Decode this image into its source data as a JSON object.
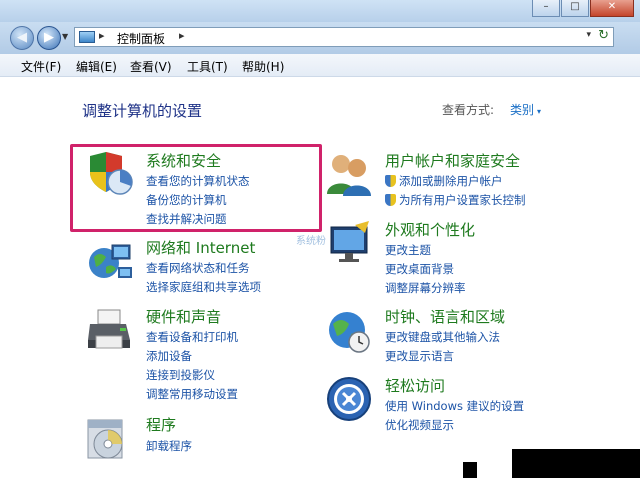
{
  "window": {
    "minimize": "–",
    "maximize": "□",
    "close": "✕"
  },
  "address": {
    "crumb": "控制面板",
    "sep": "▸",
    "dropdown": "▾",
    "refresh": "↻"
  },
  "menu": [
    "文件(F)",
    "编辑(E)",
    "查看(V)",
    "工具(T)",
    "帮助(H)"
  ],
  "page": {
    "title": "调整计算机的设置",
    "view_by_label": "查看方式:",
    "view_by_value": "类别"
  },
  "left_categories": [
    {
      "title": "系统和安全",
      "links": [
        "查看您的计算机状态",
        "备份您的计算机",
        "查找并解决问题"
      ],
      "icon": "shield-pie-icon"
    },
    {
      "title": "网络和 Internet",
      "links": [
        "查看网络状态和任务",
        "选择家庭组和共享选项"
      ],
      "icon": "globe-network-icon"
    },
    {
      "title": "硬件和声音",
      "links": [
        "查看设备和打印机",
        "添加设备",
        "连接到投影仪",
        "调整常用移动设置"
      ],
      "icon": "printer-icon"
    },
    {
      "title": "程序",
      "links": [
        "卸载程序"
      ],
      "icon": "programs-disc-icon"
    }
  ],
  "right_categories": [
    {
      "title": "用户帐户和家庭安全",
      "links": [
        "添加或删除用户帐户",
        "为所有用户设置家长控制"
      ],
      "icon": "users-icon"
    },
    {
      "title": "外观和个性化",
      "links": [
        "更改主题",
        "更改桌面背景",
        "调整屏幕分辨率"
      ],
      "icon": "monitor-paint-icon"
    },
    {
      "title": "时钟、语言和区域",
      "links": [
        "更改键盘或其他输入法",
        "更改显示语言"
      ],
      "icon": "globe-clock-icon"
    },
    {
      "title": "轻松访问",
      "links": [
        "使用 Windows 建议的设置",
        "优化视频显示"
      ],
      "icon": "ease-of-access-icon"
    }
  ],
  "watermark": "系统粉",
  "colors": {
    "title_green": "#1e7a1e",
    "link_blue": "#1c53a6",
    "highlight": "#d0226a",
    "page_title": "#1e3287"
  }
}
